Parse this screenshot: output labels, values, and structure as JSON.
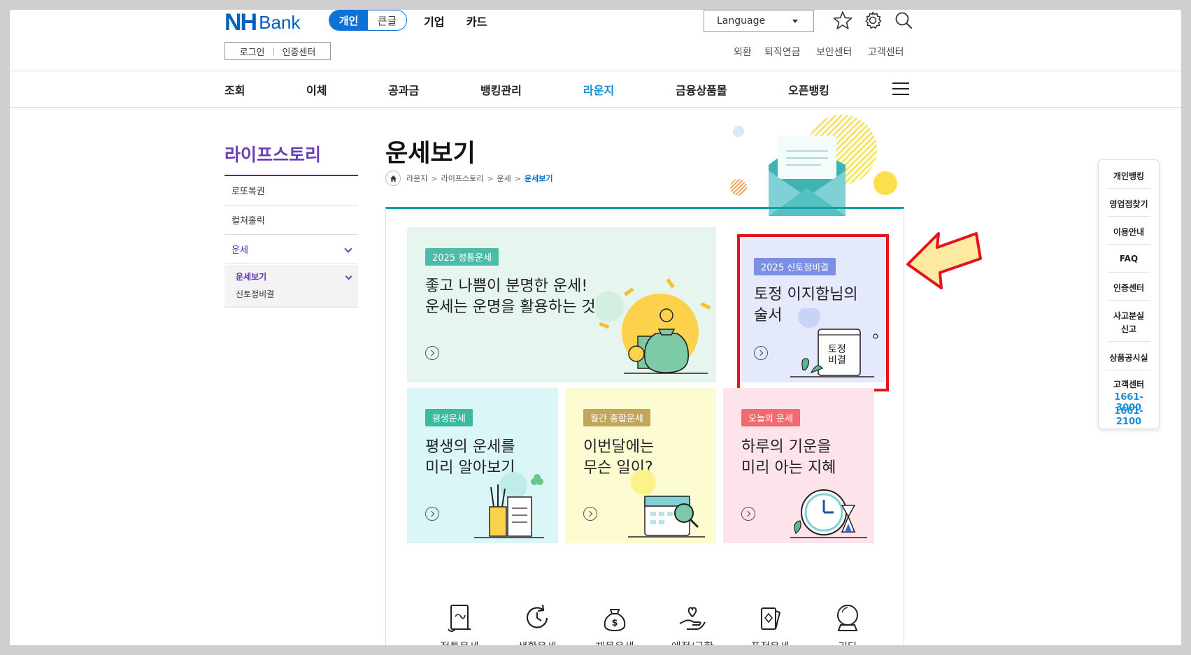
{
  "header": {
    "logo_nh": "NH",
    "logo_bank": "Bank",
    "mode_active": "개인",
    "mode_inactive": "큰글",
    "top_links": [
      "기업",
      "카드"
    ],
    "language_label": "Language",
    "login": "로그인",
    "cert_center": "인증센터",
    "util_links": [
      "외환",
      "퇴직연금",
      "보안센터",
      "고객센터"
    ],
    "gnb": [
      "조회",
      "이체",
      "공과금",
      "뱅킹관리",
      "라운지",
      "금융상품몰",
      "오픈뱅킹"
    ],
    "gnb_active": "라운지"
  },
  "lnb": {
    "title": "라이프스토리",
    "items": [
      "로또복권",
      "컬쳐홀릭",
      "운세"
    ],
    "sub_selected": "운세보기",
    "sub_item": "신토정비결"
  },
  "main": {
    "title": "운세보기",
    "breadcrumb": [
      "라운지",
      "라이프스토리",
      "운세",
      "운세보기"
    ]
  },
  "cards": [
    {
      "badge": "2025 정통운세",
      "line1": "좋고 나쁨이 분명한 운세!",
      "line2": "운세는 운명을 활용하는 것",
      "bg": "#e6f5ee",
      "badge_color": "#4cbcaa"
    },
    {
      "badge": "2025 신토정비결",
      "line1": "토정 이지함님의",
      "line2": "술서",
      "bg": "#e4e9fb",
      "badge_color": "#7b90e3",
      "book_text1": "토정",
      "book_text2": "비결"
    },
    {
      "badge": "평생운세",
      "line1": "평생의 운세를",
      "line2": "미리 알아보기",
      "bg": "#daf6f7",
      "badge_color": "#3cb99e"
    },
    {
      "badge": "월간 종합운세",
      "line1": "이번달에는",
      "line2": "무슨 일이?",
      "bg": "#fdfbd2",
      "badge_color": "#c4a55d"
    },
    {
      "badge": "오늘의 운세",
      "line1": "하루의 기운을",
      "line2": "미리 아는 지혜",
      "bg": "#fde3ea",
      "badge_color": "#f06a72"
    }
  ],
  "categories": [
    "정통운세",
    "생활운세",
    "재물운세",
    "애정/궁합",
    "퓨전운세",
    "기타"
  ],
  "quick": {
    "items": [
      "개인뱅킹",
      "영업점찾기",
      "이용안내",
      "FAQ",
      "인증센터",
      "사고분실",
      "신고",
      "상품공시실",
      "고객센터"
    ],
    "phones": [
      "1661-3000",
      "1661-2100"
    ]
  },
  "colors": {
    "brand": "#0060c0",
    "accent_teal": "#11a0a4",
    "lnb_purple": "#6a3fb5",
    "highlight_red": "#e5131e",
    "arrow_fill": "#fde9a0"
  }
}
